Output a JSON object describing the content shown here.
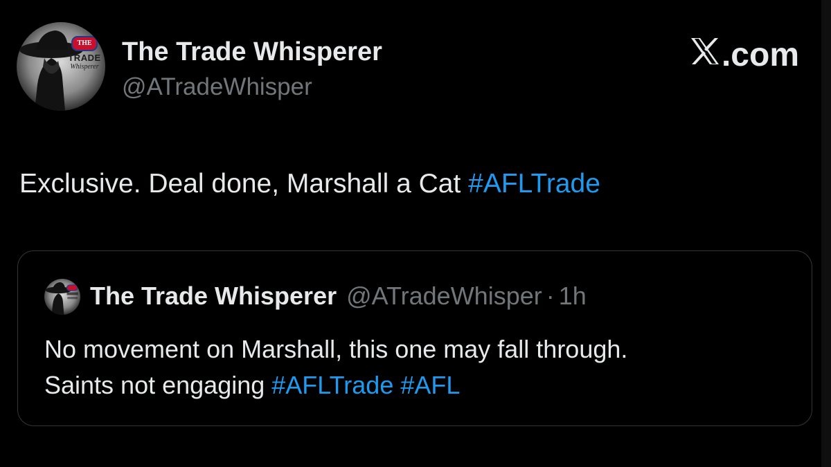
{
  "tweet": {
    "author_name": "The Trade Whisperer",
    "author_handle": "@ATradeWhisper",
    "text": "Exclusive. Deal done, Marshall a Cat ",
    "hashtag": "#AFLTrade"
  },
  "brand": {
    "label": ".com",
    "icon": "x-logo-icon"
  },
  "avatar_logo": {
    "top": "THE",
    "middle": "TRADE",
    "bottom": "Whisperer"
  },
  "quoted_tweet": {
    "author_name": "The Trade Whisperer",
    "author_handle": "@ATradeWhisper",
    "separator": "·",
    "time": "1h",
    "line1": "No movement on Marshall, this one may fall through.",
    "line2_text": "Saints not engaging ",
    "hashtag1": "#AFLTrade",
    "hashtag2": "#AFL"
  },
  "colors": {
    "background": "#000000",
    "text": "#e7e9ea",
    "secondary": "#71767b",
    "link": "#1d9bf0",
    "border": "#333639"
  }
}
